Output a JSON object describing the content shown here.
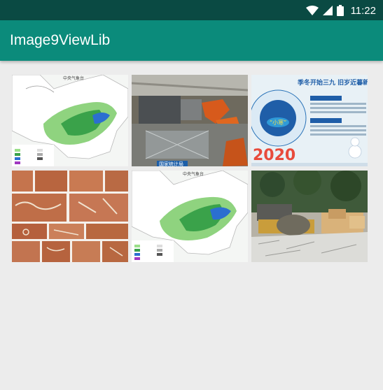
{
  "status_bar": {
    "time": "11:22",
    "icons": [
      "wifi-icon",
      "cell-signal-icon",
      "battery-icon"
    ]
  },
  "app_bar": {
    "title": "Image9ViewLib",
    "color": "#0b8b7b",
    "status_color": "#0a4a43"
  },
  "grid": {
    "items": [
      {
        "name": "weather-map-image",
        "title": "中央气象台"
      },
      {
        "name": "factory-robots-image",
        "caption": "国家统计局"
      },
      {
        "name": "solar-term-poster-image",
        "heading": "季冬开始三九 旧岁近暮新",
        "badge": "“小寒”",
        "year": "2020"
      },
      {
        "name": "rock-art-collage-image"
      },
      {
        "name": "weather-map-image-2",
        "title": "中央气象台"
      },
      {
        "name": "construction-site-image"
      }
    ]
  }
}
